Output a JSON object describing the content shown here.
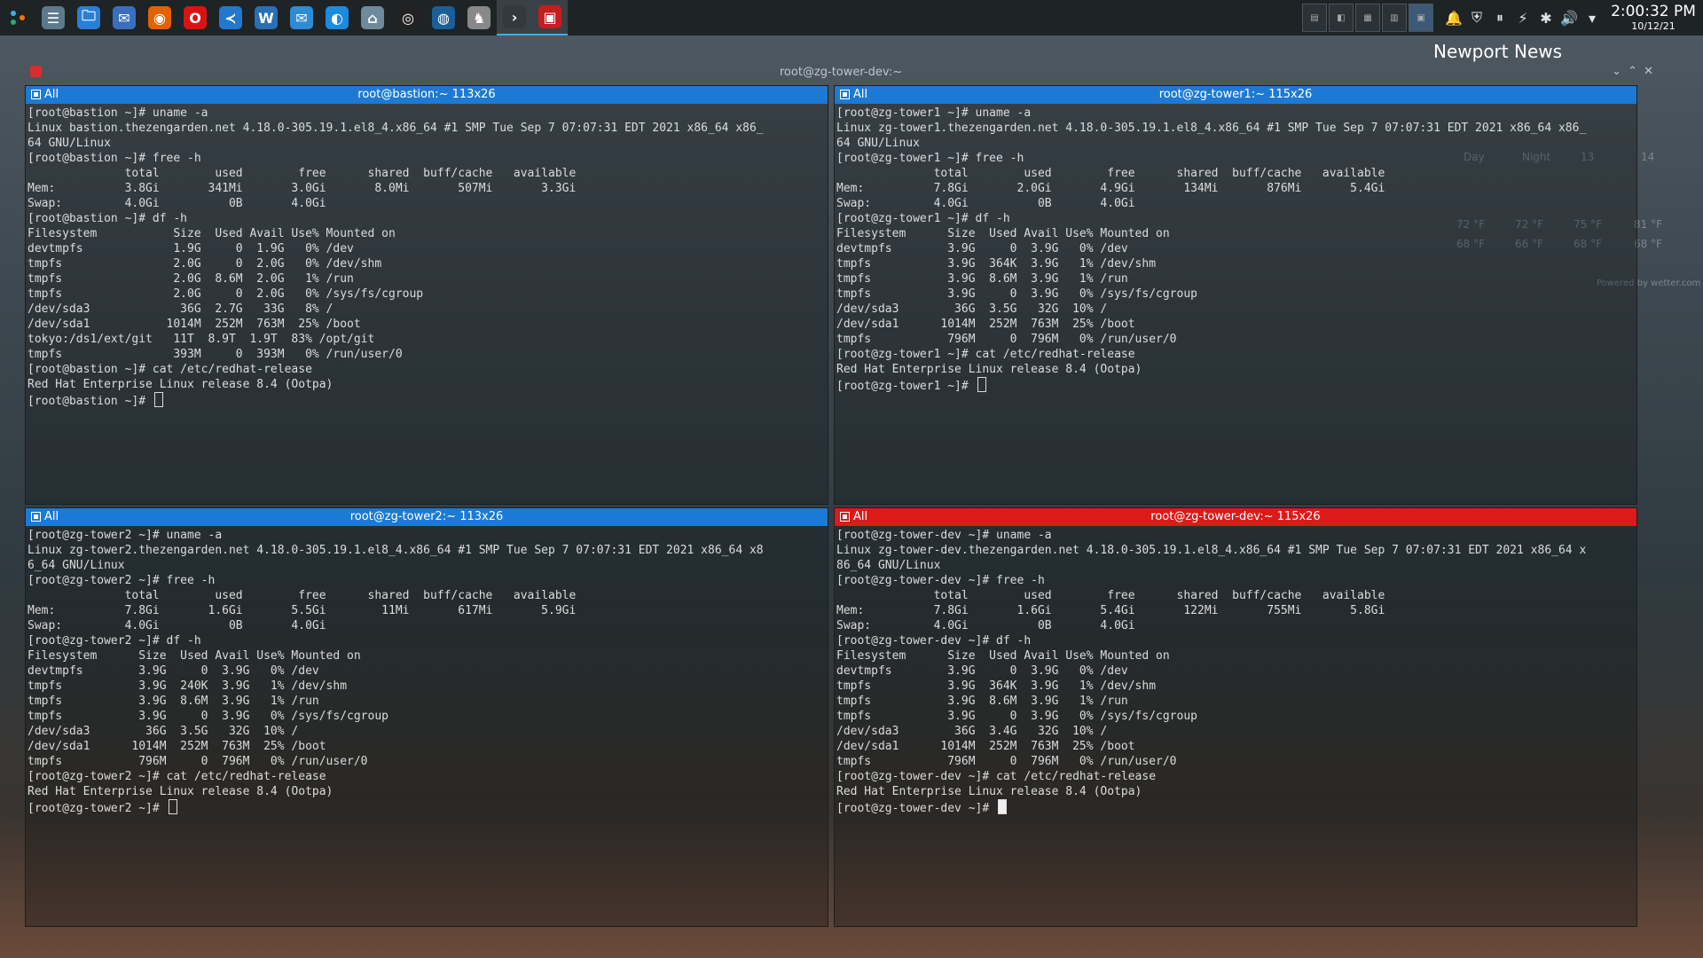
{
  "taskbar": {
    "launcher_icon": "kde-launcher-icon",
    "apps": [
      {
        "name": "system-settings-icon",
        "glyph": "☰",
        "color": "#5e7a8a"
      },
      {
        "name": "file-manager-icon",
        "glyph": "🗀",
        "color": "#2a7fd4"
      },
      {
        "name": "thunderbird-icon",
        "glyph": "✉",
        "color": "#3a6fbf"
      },
      {
        "name": "firefox-icon",
        "glyph": "◉",
        "color": "#e66000"
      },
      {
        "name": "opera-icon",
        "glyph": "O",
        "color": "#d11"
      },
      {
        "name": "vscode-icon",
        "glyph": "≺",
        "color": "#2478cc"
      },
      {
        "name": "writer-icon",
        "glyph": "W",
        "color": "#2a6fb3"
      },
      {
        "name": "messaging-icon",
        "glyph": "✉",
        "color": "#2e8bd6"
      },
      {
        "name": "browser-icon",
        "glyph": "◐",
        "color": "#1b8be0"
      },
      {
        "name": "network-icon",
        "glyph": "⌂",
        "color": "#6f8a9a"
      },
      {
        "name": "obs-icon",
        "glyph": "◎",
        "color": "#222"
      },
      {
        "name": "steam-icon",
        "glyph": "◍",
        "color": "#1b5f98"
      },
      {
        "name": "dragon-icon",
        "glyph": "♞",
        "color": "#888"
      },
      {
        "name": "konsole-icon",
        "glyph": "›",
        "color": "#33393d"
      },
      {
        "name": "terminal-active-icon",
        "glyph": "▣",
        "color": "#c41e1e"
      }
    ],
    "tray_icons": [
      "bell-icon",
      "bitwarden-icon",
      "pause-icon",
      "network-manager-icon",
      "bluetooth-icon",
      "volume-icon",
      "chevron-up-icon"
    ],
    "clock": {
      "time": "2:00:32 PM",
      "date": "10/12/21"
    }
  },
  "weather": {
    "city": "Newport News",
    "columns": [
      "Day",
      "Night",
      "13",
      "14"
    ],
    "highs": [
      "72 °F",
      "72 °F",
      "75 °F",
      "81 °F"
    ],
    "lows": [
      "68 °F",
      "66 °F",
      "68 °F",
      "68 °F"
    ],
    "credit": "Powered by wetter.com"
  },
  "window": {
    "title": "root@zg-tower-dev:~"
  },
  "panes": [
    {
      "badge": "All",
      "title": "root@bastion:~ 113x26",
      "color": "#1d7ad4",
      "lines": [
        "[root@bastion ~]# uname -a",
        "Linux bastion.thezengarden.net 4.18.0-305.19.1.el8_4.x86_64 #1 SMP Tue Sep 7 07:07:31 EDT 2021 x86_64 x86_",
        "64 GNU/Linux",
        "[root@bastion ~]# free -h",
        "              total        used        free      shared  buff/cache   available",
        "Mem:          3.8Gi       341Mi       3.0Gi       8.0Mi       507Mi       3.3Gi",
        "Swap:         4.0Gi          0B       4.0Gi",
        "[root@bastion ~]# df -h",
        "Filesystem           Size  Used Avail Use% Mounted on",
        "devtmpfs             1.9G     0  1.9G   0% /dev",
        "tmpfs                2.0G     0  2.0G   0% /dev/shm",
        "tmpfs                2.0G  8.6M  2.0G   1% /run",
        "tmpfs                2.0G     0  2.0G   0% /sys/fs/cgroup",
        "/dev/sda3             36G  2.7G   33G   8% /",
        "/dev/sda1           1014M  252M  763M  25% /boot",
        "tokyo:/ds1/ext/git   11T  8.9T  1.9T  83% /opt/git",
        "tmpfs                393M     0  393M   0% /run/user/0",
        "[root@bastion ~]# cat /etc/redhat-release",
        "Red Hat Enterprise Linux release 8.4 (Ootpa)"
      ],
      "prompt": "[root@bastion ~]# "
    },
    {
      "badge": "All",
      "title": "root@zg-tower1:~ 115x26",
      "color": "#1d7ad4",
      "lines": [
        "[root@zg-tower1 ~]# uname -a",
        "Linux zg-tower1.thezengarden.net 4.18.0-305.19.1.el8_4.x86_64 #1 SMP Tue Sep 7 07:07:31 EDT 2021 x86_64 x86_",
        "64 GNU/Linux",
        "[root@zg-tower1 ~]# free -h",
        "              total        used        free      shared  buff/cache   available",
        "Mem:          7.8Gi       2.0Gi       4.9Gi       134Mi       876Mi       5.4Gi",
        "Swap:         4.0Gi          0B       4.0Gi",
        "[root@zg-tower1 ~]# df -h",
        "Filesystem      Size  Used Avail Use% Mounted on",
        "devtmpfs        3.9G     0  3.9G   0% /dev",
        "tmpfs           3.9G  364K  3.9G   1% /dev/shm",
        "tmpfs           3.9G  8.6M  3.9G   1% /run",
        "tmpfs           3.9G     0  3.9G   0% /sys/fs/cgroup",
        "/dev/sda3        36G  3.5G   32G  10% /",
        "/dev/sda1      1014M  252M  763M  25% /boot",
        "tmpfs           796M     0  796M   0% /run/user/0",
        "[root@zg-tower1 ~]# cat /etc/redhat-release",
        "Red Hat Enterprise Linux release 8.4 (Ootpa)"
      ],
      "prompt": "[root@zg-tower1 ~]# "
    },
    {
      "badge": "All",
      "title": "root@zg-tower2:~ 113x26",
      "color": "#1d7ad4",
      "lines": [
        "[root@zg-tower2 ~]# uname -a",
        "Linux zg-tower2.thezengarden.net 4.18.0-305.19.1.el8_4.x86_64 #1 SMP Tue Sep 7 07:07:31 EDT 2021 x86_64 x8",
        "6_64 GNU/Linux",
        "[root@zg-tower2 ~]# free -h",
        "              total        used        free      shared  buff/cache   available",
        "Mem:          7.8Gi       1.6Gi       5.5Gi        11Mi       617Mi       5.9Gi",
        "Swap:         4.0Gi          0B       4.0Gi",
        "[root@zg-tower2 ~]# df -h",
        "Filesystem      Size  Used Avail Use% Mounted on",
        "devtmpfs        3.9G     0  3.9G   0% /dev",
        "tmpfs           3.9G  240K  3.9G   1% /dev/shm",
        "tmpfs           3.9G  8.6M  3.9G   1% /run",
        "tmpfs           3.9G     0  3.9G   0% /sys/fs/cgroup",
        "/dev/sda3        36G  3.5G   32G  10% /",
        "/dev/sda1      1014M  252M  763M  25% /boot",
        "tmpfs           796M     0  796M   0% /run/user/0",
        "[root@zg-tower2 ~]# cat /etc/redhat-release",
        "Red Hat Enterprise Linux release 8.4 (Ootpa)"
      ],
      "prompt": "[root@zg-tower2 ~]# "
    },
    {
      "badge": "All",
      "title": "root@zg-tower-dev:~ 115x26",
      "color": "#dc1a1a",
      "lines": [
        "[root@zg-tower-dev ~]# uname -a",
        "Linux zg-tower-dev.thezengarden.net 4.18.0-305.19.1.el8_4.x86_64 #1 SMP Tue Sep 7 07:07:31 EDT 2021 x86_64 x",
        "86_64 GNU/Linux",
        "[root@zg-tower-dev ~]# free -h",
        "              total        used        free      shared  buff/cache   available",
        "Mem:          7.8Gi       1.6Gi       5.4Gi       122Mi       755Mi       5.8Gi",
        "Swap:         4.0Gi          0B       4.0Gi",
        "[root@zg-tower-dev ~]# df -h",
        "Filesystem      Size  Used Avail Use% Mounted on",
        "devtmpfs        3.9G     0  3.9G   0% /dev",
        "tmpfs           3.9G  364K  3.9G   1% /dev/shm",
        "tmpfs           3.9G  8.6M  3.9G   1% /run",
        "tmpfs           3.9G     0  3.9G   0% /sys/fs/cgroup",
        "/dev/sda3        36G  3.4G   32G  10% /",
        "/dev/sda1      1014M  252M  763M  25% /boot",
        "tmpfs           796M     0  796M   0% /run/user/0",
        "[root@zg-tower-dev ~]# cat /etc/redhat-release",
        "Red Hat Enterprise Linux release 8.4 (Ootpa)"
      ],
      "prompt": "[root@zg-tower-dev ~]# "
    }
  ]
}
